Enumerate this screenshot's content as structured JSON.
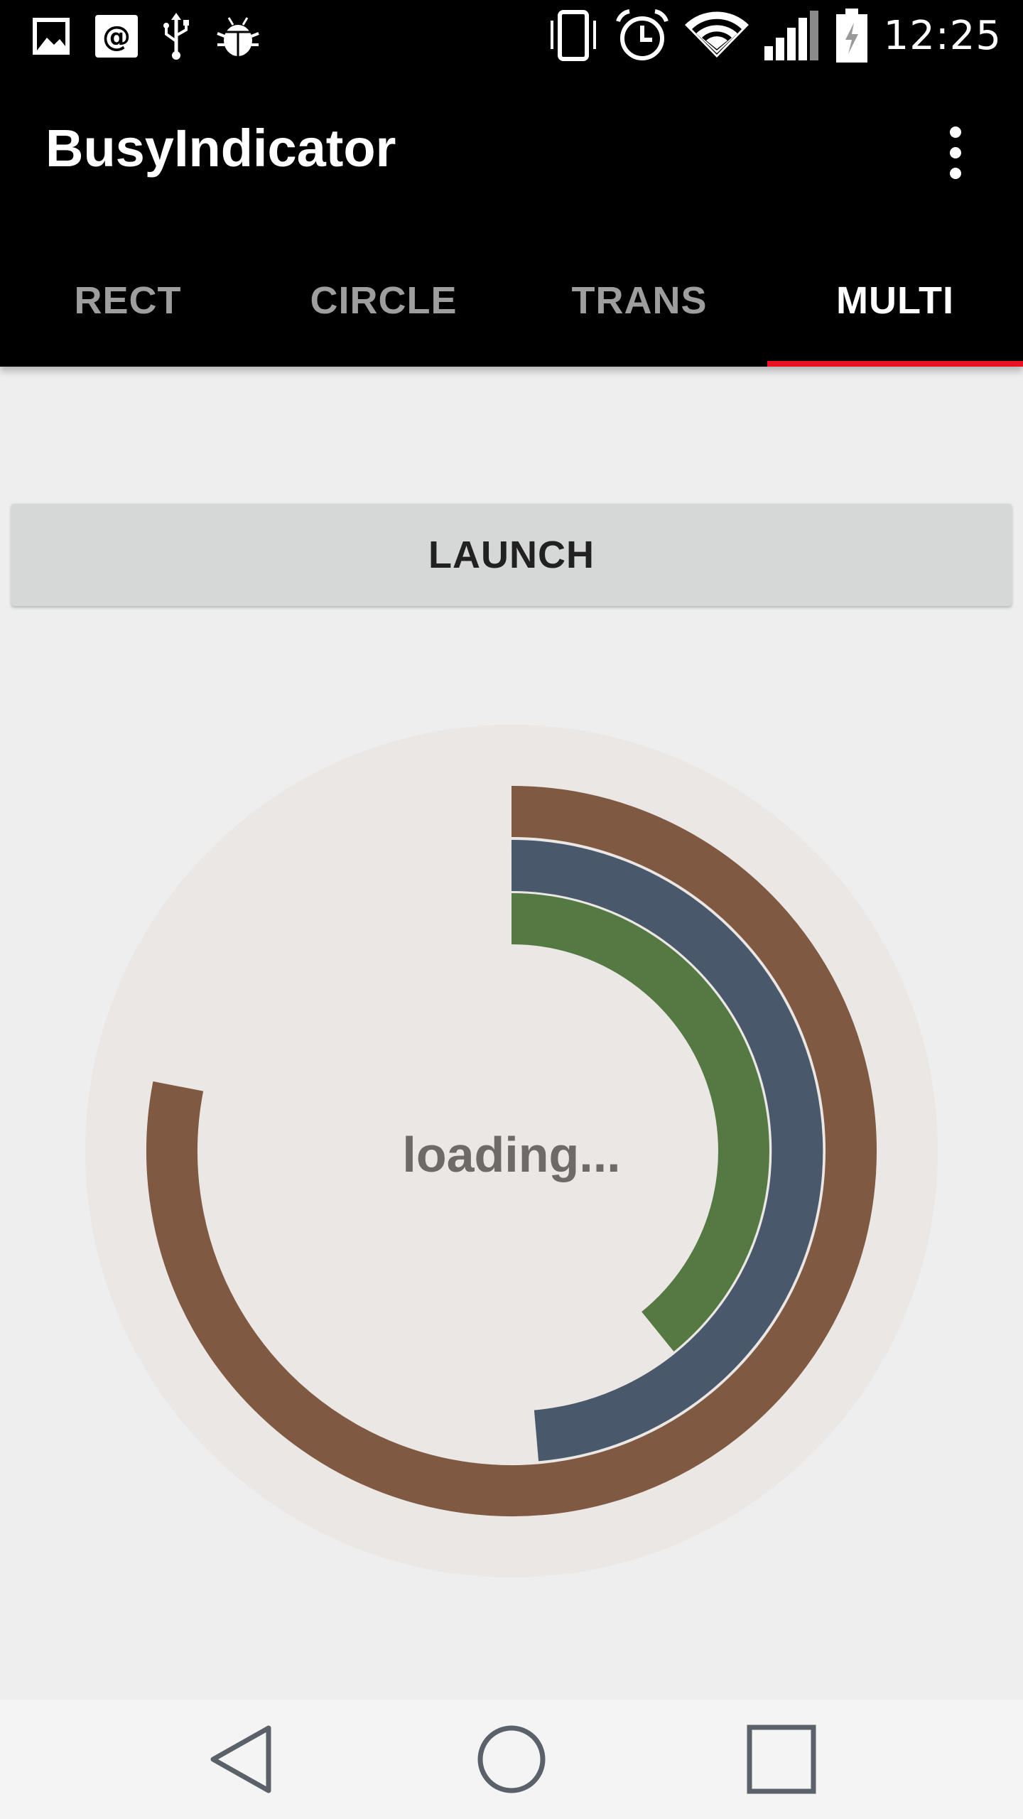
{
  "status_bar": {
    "time": "12:25",
    "left_icons": [
      "image-icon",
      "at-sign-icon",
      "usb-icon",
      "android-bug-icon"
    ],
    "right_icons": [
      "vibrate-icon",
      "alarm-icon",
      "wifi-icon",
      "signal-icon",
      "battery-charging-icon"
    ]
  },
  "app_bar": {
    "title": "BusyIndicator",
    "overflow_icon": "more-vert-icon"
  },
  "tabs": [
    {
      "label": "RECT",
      "active": false
    },
    {
      "label": "CIRCLE",
      "active": false
    },
    {
      "label": "TRANS",
      "active": false
    },
    {
      "label": "MULTI",
      "active": true
    }
  ],
  "accent_color": "#e8131f",
  "launch_button": {
    "label": "LAUNCH"
  },
  "busy_indicator": {
    "text": "loading...",
    "background_color": "#ebe7e5",
    "arcs": [
      {
        "color": "#7f5942",
        "start_deg": 0,
        "sweep_deg": 281
      },
      {
        "color": "#4a586b",
        "start_deg": 0,
        "sweep_deg": 175
      },
      {
        "color": "#557942",
        "start_deg": 0,
        "sweep_deg": 141
      }
    ]
  },
  "nav_bar": {
    "icons": [
      "back-icon",
      "home-icon",
      "recents-icon"
    ]
  }
}
